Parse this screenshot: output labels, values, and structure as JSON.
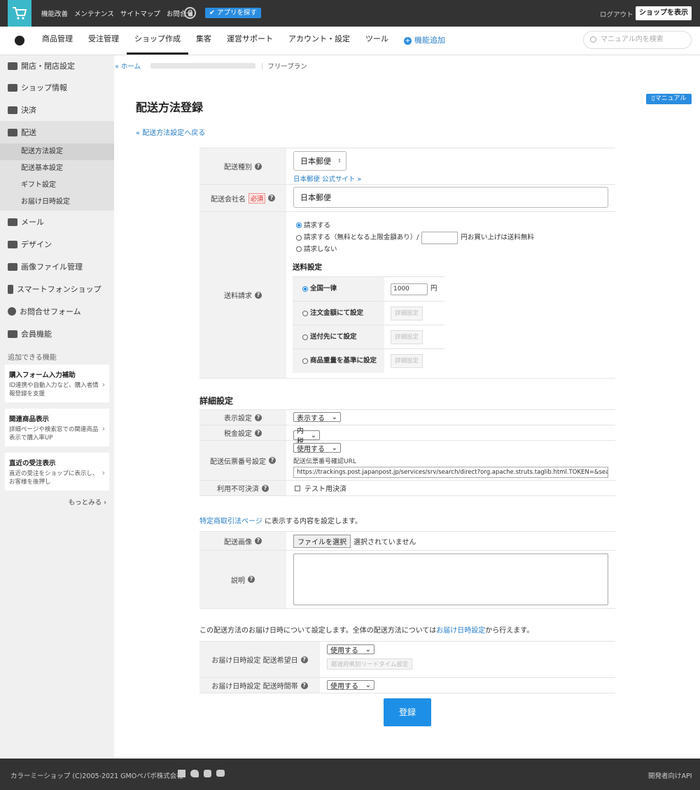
{
  "topbar": {
    "links": [
      "機能改善",
      "メンテナンス",
      "サイトマップ",
      "お問合せ"
    ],
    "app_button": "アプリを探す",
    "logout": "ログアウト",
    "show_shop": "ショップを表示"
  },
  "nav": {
    "items": [
      "商品管理",
      "受注管理",
      "ショップ作成",
      "集客",
      "運営サポート",
      "アカウント・設定",
      "ツール"
    ],
    "add_feature": "機能追加",
    "search_placeholder": "マニュアル内を検索"
  },
  "sidebar": {
    "items": [
      {
        "label": "開店・閉店設定"
      },
      {
        "label": "ショップ情報"
      },
      {
        "label": "決済"
      },
      {
        "label": "配送"
      },
      {
        "label": "メール"
      },
      {
        "label": "デザイン"
      },
      {
        "label": "画像ファイル管理"
      },
      {
        "label": "スマートフォンショップ"
      },
      {
        "label": "お問合せフォーム"
      },
      {
        "label": "会員機能"
      }
    ],
    "sub_items": [
      "配送方法設定",
      "配送基本設定",
      "ギフト設定",
      "お届け日時設定"
    ],
    "section_title": "追加できる機能",
    "promos": [
      {
        "title": "購入フォーム入力補助",
        "desc": "ID連携や自動入力など、購入者情報登録を支援"
      },
      {
        "title": "関連商品表示",
        "desc": "詳細ページや検索窓での関連商品表示で購入率UP"
      },
      {
        "title": "直近の受注表示",
        "desc": "直近の受注をショップに表示し、お客様を後押し"
      }
    ],
    "more": "もっとみる"
  },
  "breadcrumb": {
    "home": "« ホーム",
    "plan": "フリープラン"
  },
  "page": {
    "title": "配送方法登録",
    "manual": "マニュアル",
    "back_link": "« 配送方法設定へ戻る"
  },
  "form": {
    "carrier_type_label": "配送種別",
    "carrier_type_value": "日本郵便",
    "carrier_link": "日本郵便 公式サイト »",
    "company_label": "配送会社名",
    "required": "必須",
    "company_value": "日本郵便",
    "charge_label": "送料請求",
    "charge_opt1": "請求する",
    "charge_opt2": "請求する（無料となる上限金額あり）/",
    "charge_opt2_suffix": "円お買い上げは送料無料",
    "charge_opt3": "請求しない",
    "fee_heading": "送料設定",
    "fee_flat": "全国一律",
    "fee_flat_value": "1000",
    "fee_yen": "円",
    "fee_by_amount": "注文金額にて設定",
    "fee_by_dest": "送付先にて設定",
    "fee_by_weight": "商品重量を基準に設定",
    "detail_btn": "詳細設定"
  },
  "details": {
    "heading": "詳細設定",
    "display_label": "表示設定",
    "display_value": "表示する",
    "tax_label": "税金設定",
    "tax_value": "内税",
    "tracking_label": "配送伝票番号設定",
    "tracking_value": "使用する",
    "tracking_url_label": "配送伝票番号確認URL",
    "tracking_url": "https://trackings.post.japanpost.jp/services/srv/search/direct?org.apache.struts.taglib.html.TOKEN=&sea",
    "unavailable_label": "利用不可決済",
    "test_payment": "テスト用決済"
  },
  "tokusho": {
    "link": "特定商取引法ページ",
    "text": " に表示する内容を設定します。",
    "image_label": "配送画像",
    "file_button": "ファイルを選択",
    "no_file": "選択されていません",
    "desc_label": "説明"
  },
  "delivery": {
    "note_prefix": "この配送方法のお届け日時について設定します。全体の配送方法については",
    "note_link": "お届け日時設定",
    "note_suffix": "から行えます。",
    "date_label": "お届け日時設定 配送希望日",
    "date_value": "使用する",
    "lead_time_btn": "都道府県別リードタイム設定",
    "time_label": "お届け日時設定 配送時間帯",
    "time_value": "使用する"
  },
  "submit": "登録",
  "footer": {
    "copyright": "カラーミーショップ (C)2005-2021 GMOペパボ株式会社",
    "api": "開発者向けAPI"
  }
}
